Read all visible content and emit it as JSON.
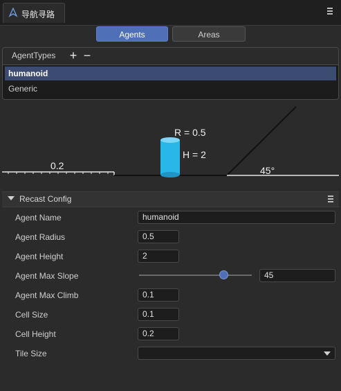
{
  "window": {
    "tab_title": "导航寻路"
  },
  "segmented": {
    "agents_label": "Agents",
    "areas_label": "Areas"
  },
  "agent_types": {
    "title": "AgentTypes",
    "add_label": "+",
    "remove_label": "−",
    "items": [
      {
        "label": "humanoid",
        "selected": true
      },
      {
        "label": "Generic",
        "selected": false
      }
    ]
  },
  "diagram": {
    "radius_text": "R = 0.5",
    "height_text": "H = 2",
    "step_text": "0.2",
    "slope_text": "45°",
    "cylinder_color": "#29b6e8"
  },
  "recast": {
    "section_title": "Recast Config",
    "fields": {
      "agent_name": {
        "label": "Agent Name",
        "value": "humanoid"
      },
      "agent_radius": {
        "label": "Agent Radius",
        "value": "0.5"
      },
      "agent_height": {
        "label": "Agent Height",
        "value": "2"
      },
      "agent_max_slope": {
        "label": "Agent Max Slope",
        "value": "45",
        "slider_fraction": 0.75
      },
      "agent_max_climb": {
        "label": "Agent Max Climb",
        "value": "0.1"
      },
      "cell_size": {
        "label": "Cell Size",
        "value": "0.1"
      },
      "cell_height": {
        "label": "Cell Height",
        "value": "0.2"
      },
      "tile_size": {
        "label": "Tile Size",
        "value": ""
      }
    }
  },
  "colors": {
    "accent": "#4f6fb7",
    "selection": "#3c4b72",
    "background": "#2b2b2b"
  }
}
